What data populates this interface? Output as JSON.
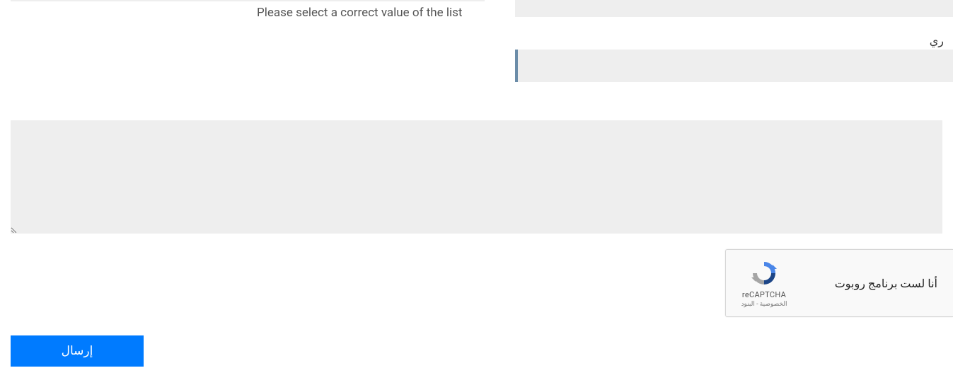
{
  "form": {
    "topLeftLabel": "",
    "validationMessage": "Please select a correct value of the list",
    "rightFieldLabelPartial": "ري",
    "textarea": "",
    "submitLabel": "إرسال"
  },
  "recaptcha": {
    "text": "أنا لست برنامج روبوت",
    "brand": "reCAPTCHA",
    "privacyLabel": "الخصوصية",
    "separator": " - ",
    "termsLabel": "البنود"
  }
}
